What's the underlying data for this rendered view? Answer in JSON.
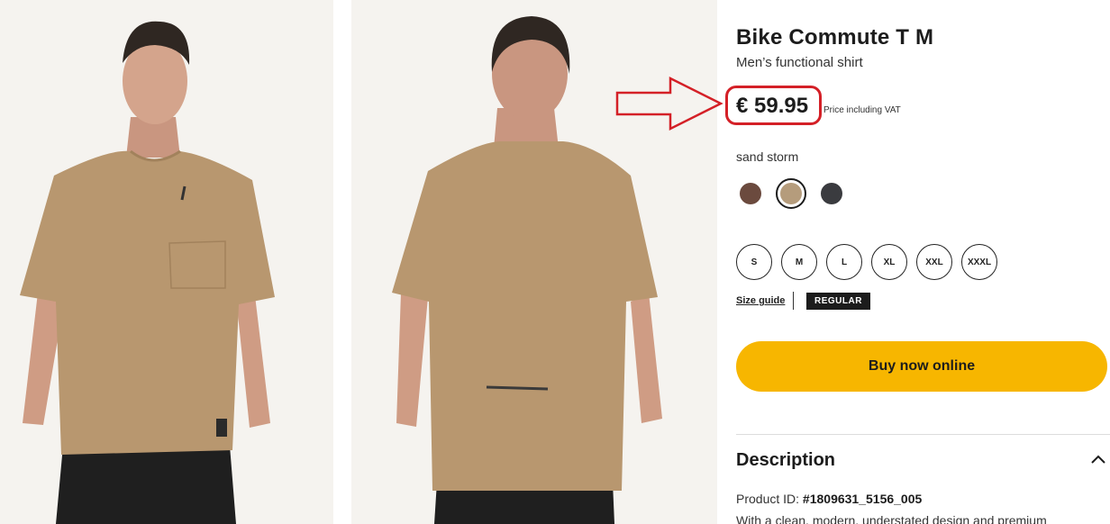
{
  "product": {
    "title": "Bike Commute T M",
    "subtitle": "Men’s functional shirt",
    "price": "€ 59.95",
    "price_note": "Price including VAT"
  },
  "colors": {
    "selected_label": "sand storm",
    "swatches": [
      {
        "name": "brown",
        "hex": "#6b4a3e",
        "selected": false
      },
      {
        "name": "sand storm",
        "hex": "#b59c7c",
        "selected": true
      },
      {
        "name": "dark grey",
        "hex": "#3a3b3f",
        "selected": false
      }
    ]
  },
  "sizes": [
    "S",
    "M",
    "L",
    "XL",
    "XXL",
    "XXXL"
  ],
  "size_guide_label": "Size guide",
  "fit_label": "REGULAR",
  "buy_label": "Buy now online",
  "description": {
    "heading": "Description",
    "product_id_label": "Product ID: ",
    "product_id": "#1809631_5156_005",
    "text": "With a clean, modern, understated design and premium"
  },
  "theme": {
    "accent": "#f7b600",
    "highlight": "#d42027",
    "shirt": "#b8976f"
  }
}
